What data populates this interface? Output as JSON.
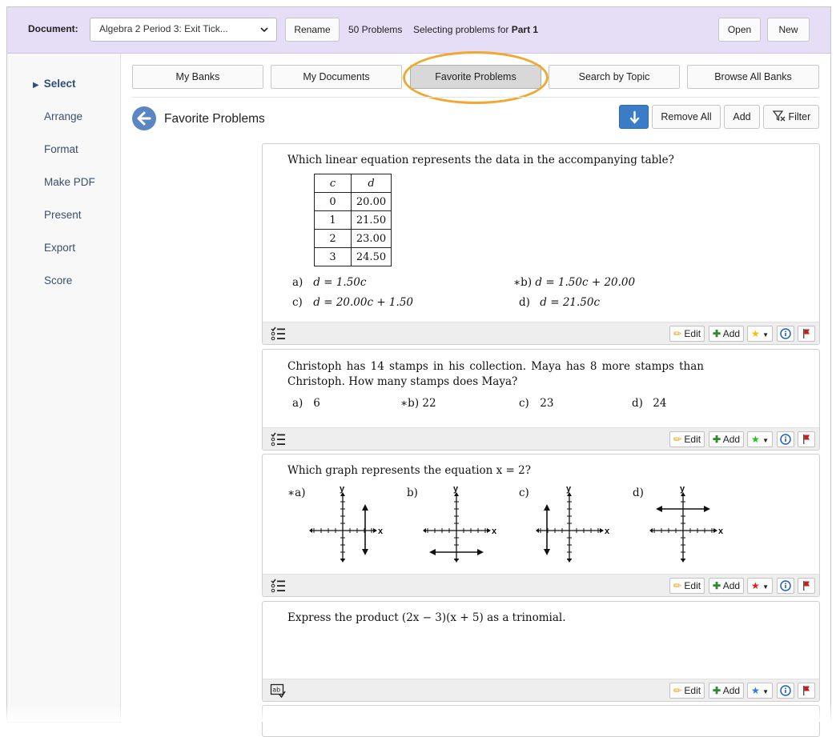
{
  "toolbar": {
    "document_label": "Document:",
    "document_value": "Algebra 2 Period 3: Exit Tick...",
    "rename": "Rename",
    "problem_count": "50 Problems",
    "selecting_prefix": "Selecting problems for",
    "selecting_part": "Part 1",
    "open": "Open",
    "new": "New"
  },
  "sidebar": {
    "items": [
      {
        "label": "Select",
        "active": true
      },
      {
        "label": "Arrange"
      },
      {
        "label": "Format"
      },
      {
        "label": "Make PDF"
      },
      {
        "label": "Present"
      },
      {
        "label": "Export"
      },
      {
        "label": "Score"
      }
    ]
  },
  "tabs": [
    "My Banks",
    "My Documents",
    "Favorite Problems",
    "Search by Topic",
    "Browse All Banks"
  ],
  "active_tab": "Favorite Problems",
  "main": {
    "title": "Favorite Problems",
    "remove_all": "Remove All",
    "add": "Add",
    "filter": "Filter"
  },
  "footer_buttons": {
    "edit": "Edit",
    "add": "Add"
  },
  "problems": [
    {
      "question": "Which linear equation represents the data in the accompanying table?",
      "table": {
        "headers": [
          "c",
          "d"
        ],
        "rows": [
          [
            "0",
            "20.00"
          ],
          [
            "1",
            "21.50"
          ],
          [
            "2",
            "23.00"
          ],
          [
            "3",
            "24.50"
          ]
        ]
      },
      "choices": [
        {
          "label": "a)",
          "text": "d = 1.50c"
        },
        {
          "label": "∗b)",
          "text": "d = 1.50c + 20.00"
        },
        {
          "label": "c)",
          "text": "d = 20.00c + 1.50"
        },
        {
          "label": "d)",
          "text": "d = 21.50c"
        }
      ],
      "star_color": "#f2c200",
      "type_icon": "checklist-icon"
    },
    {
      "question": "Christoph has 14 stamps in his collection. Maya has 8 more stamps than Christoph. How many stamps does Maya?",
      "choices": [
        {
          "label": "a)",
          "text": "6"
        },
        {
          "label": "∗b)",
          "text": "22"
        },
        {
          "label": "c)",
          "text": "23"
        },
        {
          "label": "d)",
          "text": "24"
        }
      ],
      "star_color": "#22c022",
      "type_icon": "checklist-icon"
    },
    {
      "question": "Which graph represents the equation x = 2?",
      "choices": [
        {
          "label": "∗a)"
        },
        {
          "label": "b)"
        },
        {
          "label": "c)"
        },
        {
          "label": "d)"
        }
      ],
      "axis_x": "x",
      "axis_y": "y",
      "star_color": "#e02020",
      "type_icon": "checklist-icon"
    },
    {
      "question": "Express the product (2x − 3)(x + 5) as a trinomial.",
      "star_color": "#2a7ae0",
      "type_icon": "short-answer-icon"
    }
  ]
}
